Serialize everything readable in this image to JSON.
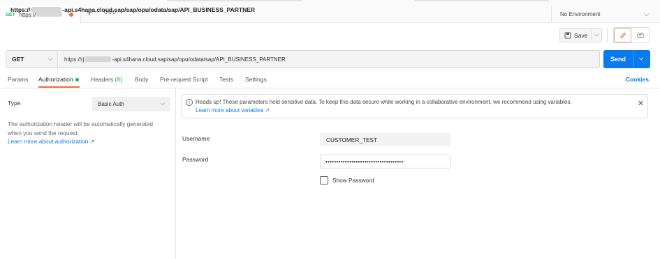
{
  "tab": {
    "method": "GET",
    "url_prefix": "https://",
    "unsaved_dot_color": "#f26b3a"
  },
  "tab_actions": {
    "new_tab": "+",
    "more": "ooo"
  },
  "environment": {
    "label": "No Environment"
  },
  "request": {
    "title_prefix": "https://",
    "title_suffix": "-api.s4hana.cloud.sap/sap/opu/odata/sap/API_BUSINESS_PARTNER",
    "save_label": "Save",
    "method": "GET",
    "url_prefix": "https://rj",
    "url_suffix": "-api.s4hana.cloud.sap/sap/opu/odata/sap/API_BUSINESS_PARTNER",
    "send_label": "Send"
  },
  "subtabs": {
    "params": "Params",
    "authorization": "Authorization",
    "headers": "Headers",
    "headers_count": "(8)",
    "body": "Body",
    "pre_request": "Pre-request Script",
    "tests": "Tests",
    "settings": "Settings",
    "cookies": "Cookies"
  },
  "auth": {
    "type_label": "Type",
    "type_value": "Basic Auth",
    "description": "The authorization header will be automatically generated when you send the request.",
    "learn_more": "Learn more about authorization ↗"
  },
  "banner": {
    "message": "Heads up! These parameters hold sensitive data. To keep this data secure while working in a collaborative environment, we recommend using variables.",
    "link": "Learn more about variables ↗"
  },
  "credentials": {
    "username_label": "Username",
    "username_value": "CUSTOMER_TEST",
    "password_label": "Password",
    "password_mask": "••••••••••••••••••••••••••••••••••••",
    "show_password_label": "Show Password"
  },
  "colors": {
    "accent": "#f26b3a",
    "send": "#097bed",
    "method_get": "#0cbb52"
  }
}
